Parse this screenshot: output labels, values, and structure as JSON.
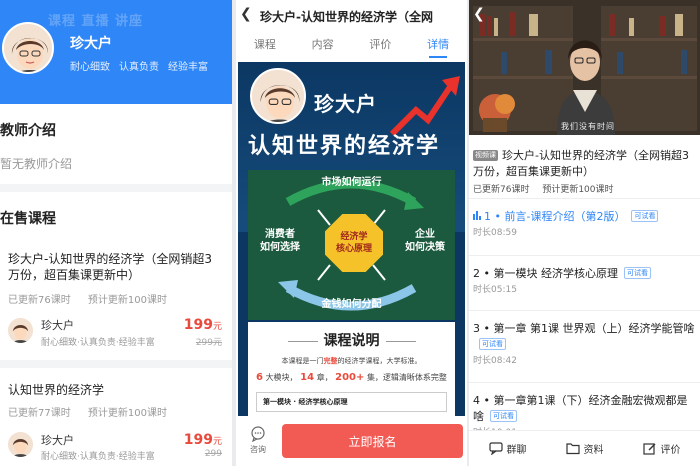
{
  "panel1": {
    "header_ghost": "课程  直播  讲座",
    "teacher_name": "珍大户",
    "tags": [
      "耐心细致",
      "认真负责",
      "经验丰富"
    ],
    "intro_title": "教师介绍",
    "intro_empty": "暂无教师介绍",
    "courses_title": "在售课程",
    "courses": [
      {
        "title": "珍大户-认知世界的经济学（全网销超3万份，超百集课更新中）",
        "updated": "已更新76课时",
        "planned": "预计更新100课时",
        "teacher": "珍大户",
        "teacher_desc": "耐心细致·认真负责·经验丰富",
        "price": "199",
        "price_unit": "元",
        "orig_price": "299元"
      },
      {
        "title": "认知世界的经济学",
        "updated": "已更新77课时",
        "planned": "预计更新100课时",
        "teacher": "珍大户",
        "teacher_desc": "耐心细致·认真负责·经验丰富",
        "price": "199",
        "price_unit": "元",
        "orig_price": "299"
      }
    ]
  },
  "panel2": {
    "title": "珍大户-认知世界的经济学（全网",
    "tabs": [
      "课程",
      "内容",
      "评价",
      "详情"
    ],
    "active_tab": "详情",
    "poster": {
      "name": "珍大户",
      "headline": "认知世界的经济学",
      "diagram": {
        "top": "市场如何运行",
        "left": "消费者\n如何选择",
        "right": "企业\n如何决策",
        "bottom": "金钱如何分配",
        "center": "经济学\n核心原理"
      },
      "outline_title": "课程说明",
      "outline_line1_a": "本课程是一门",
      "outline_line1_b": "完整",
      "outline_line1_c": "的经济学课程，大学标准。",
      "outline_line2": [
        "6",
        "大模块，",
        "14",
        "章，",
        "200+",
        "集，逻辑清晰体系完整"
      ],
      "module_row": "第一模块 · 经济学核心原理"
    },
    "consult_label": "咨询",
    "enroll_label": "立即报名"
  },
  "panel3": {
    "video_subtitle": "我们没有时间",
    "tag_video": "视频课",
    "title": "珍大户-认知世界的经济学（全网销超3万份，超百集课更新中）",
    "updated": "已更新76课时",
    "planned": "预计更新100课时",
    "try_label": "可试看",
    "lessons": [
      {
        "title": "1 • 前言-课程介绍（第2版）",
        "duration": "时长08:59",
        "try": true,
        "active": true
      },
      {
        "title": "2 • 第一模块  经济学核心原理",
        "duration": "时长05:15",
        "try": true,
        "active": false
      },
      {
        "title": "3 • 第一章 第1课 世界观（上）经济学能管啥",
        "duration": "时长08:42",
        "try": true,
        "active": false
      },
      {
        "title": "4 • 第一章第1课（下）经济金融宏微观都是啥",
        "duration": "时长10:01",
        "try": true,
        "active": false
      }
    ],
    "bottom": [
      "群聊",
      "资料",
      "评价"
    ],
    "accent": "#2f86f6"
  }
}
